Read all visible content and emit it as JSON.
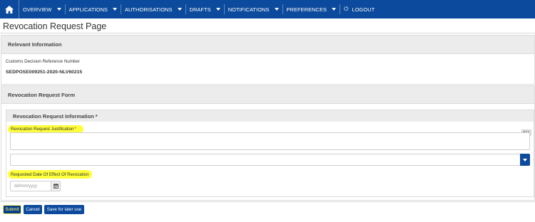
{
  "nav": {
    "items": [
      {
        "label": "OVERVIEW",
        "caret": true
      },
      {
        "label": "APPLICATIONS",
        "caret": true
      },
      {
        "label": "AUTHORISATIONS",
        "caret": true
      },
      {
        "label": "DRAFTS",
        "caret": true
      },
      {
        "label": "NOTIFICATIONS",
        "caret": true
      },
      {
        "label": "PREFERENCES",
        "caret": true
      }
    ],
    "logout_label": "LOGOUT",
    "home_icon": "home-icon",
    "logout_icon": "logout-icon",
    "bar_color": "#0b4a9c"
  },
  "page": {
    "title": "Revocation Request Page"
  },
  "relevant": {
    "heading": "Relevant Information",
    "ref_label": "Customs Decision Reference Number",
    "ref_value": "SEDPOSE009251-2020-NLV60215"
  },
  "form": {
    "heading": "Revocation Request Form",
    "section_heading": "Revocation Request Information *",
    "justification_label": "Revocation Request Justification",
    "required_marker": "*",
    "char_counter": "512",
    "select_value": "",
    "date_label": "Requested Date Of Effect Of Revocation",
    "date_placeholder": "dd/mm/yyyy",
    "highlight_color": "#ffff3b"
  },
  "actions": {
    "submit": "Submit",
    "cancel": "Cancel",
    "save": "Save for later use"
  }
}
